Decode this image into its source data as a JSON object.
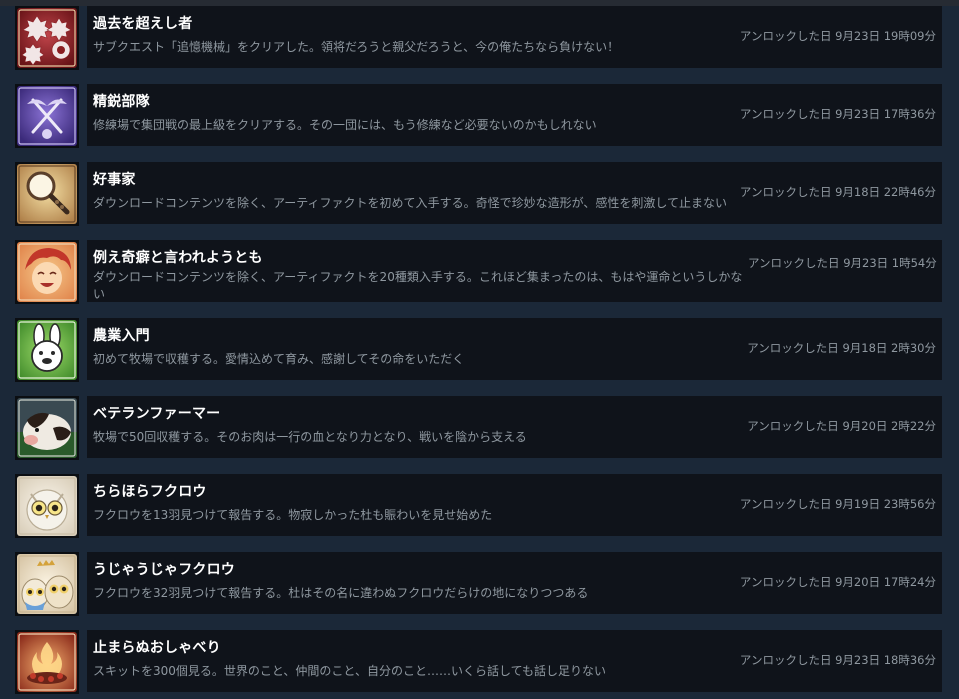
{
  "achievements": [
    {
      "title": "過去を超えし者",
      "description": "サブクエスト「追憶機械」をクリアした。領将だろうと親父だろうと、今の俺たちなら負けない！",
      "unlock": "アンロックした日 9月23日 19時09分",
      "icon": "crest-emblem-icon"
    },
    {
      "title": "精鋭部隊",
      "description": "修練場で集団戦の最上級をクリアする。その一団には、もう修練など必要ないのかもしれない",
      "unlock": "アンロックした日 9月23日 17時36分",
      "icon": "crossed-swords-icon"
    },
    {
      "title": "好事家",
      "description": "ダウンロードコンテンツを除く、アーティファクトを初めて入手する。奇怪で珍妙な造形が、感性を刺激して止まない",
      "unlock": "アンロックした日 9月18日 22時46分",
      "icon": "magnifying-glass-icon"
    },
    {
      "title": "例え奇癖と言われようとも",
      "description": "ダウンロードコンテンツを除く、アーティファクトを20種類入手する。これほど集まったのは、もはや運命というしかない",
      "unlock": "アンロックした日 9月23日 1時54分",
      "icon": "laughing-character-icon"
    },
    {
      "title": "農業入門",
      "description": "初めて牧場で収穫する。愛情込めて育み、感謝してその命をいただく",
      "unlock": "アンロックした日 9月18日 2時30分",
      "icon": "rabbit-icon"
    },
    {
      "title": "ベテランファーマー",
      "description": "牧場で50回収穫する。そのお肉は一行の血となり力となり、戦いを陰から支える",
      "unlock": "アンロックした日 9月20日 2時22分",
      "icon": "cow-icon"
    },
    {
      "title": "ちらほらフクロウ",
      "description": "フクロウを13羽見つけて報告する。物寂しかった杜も賑わいを見せ始めた",
      "unlock": "アンロックした日 9月19日 23時56分",
      "icon": "owl-icon"
    },
    {
      "title": "うじゃうじゃフクロウ",
      "description": "フクロウを32羽見つけて報告する。杜はその名に違わぬフクロウだらけの地になりつつある",
      "unlock": "アンロックした日 9月20日 17時24分",
      "icon": "owl-family-icon"
    },
    {
      "title": "止まらぬおしゃべり",
      "description": "スキットを300個見る。世界のこと、仲間のこと、自分のこと……いくら話しても話し足りない",
      "unlock": "アンロックした日 9月23日 18時36分",
      "icon": "campfire-icon"
    }
  ]
}
